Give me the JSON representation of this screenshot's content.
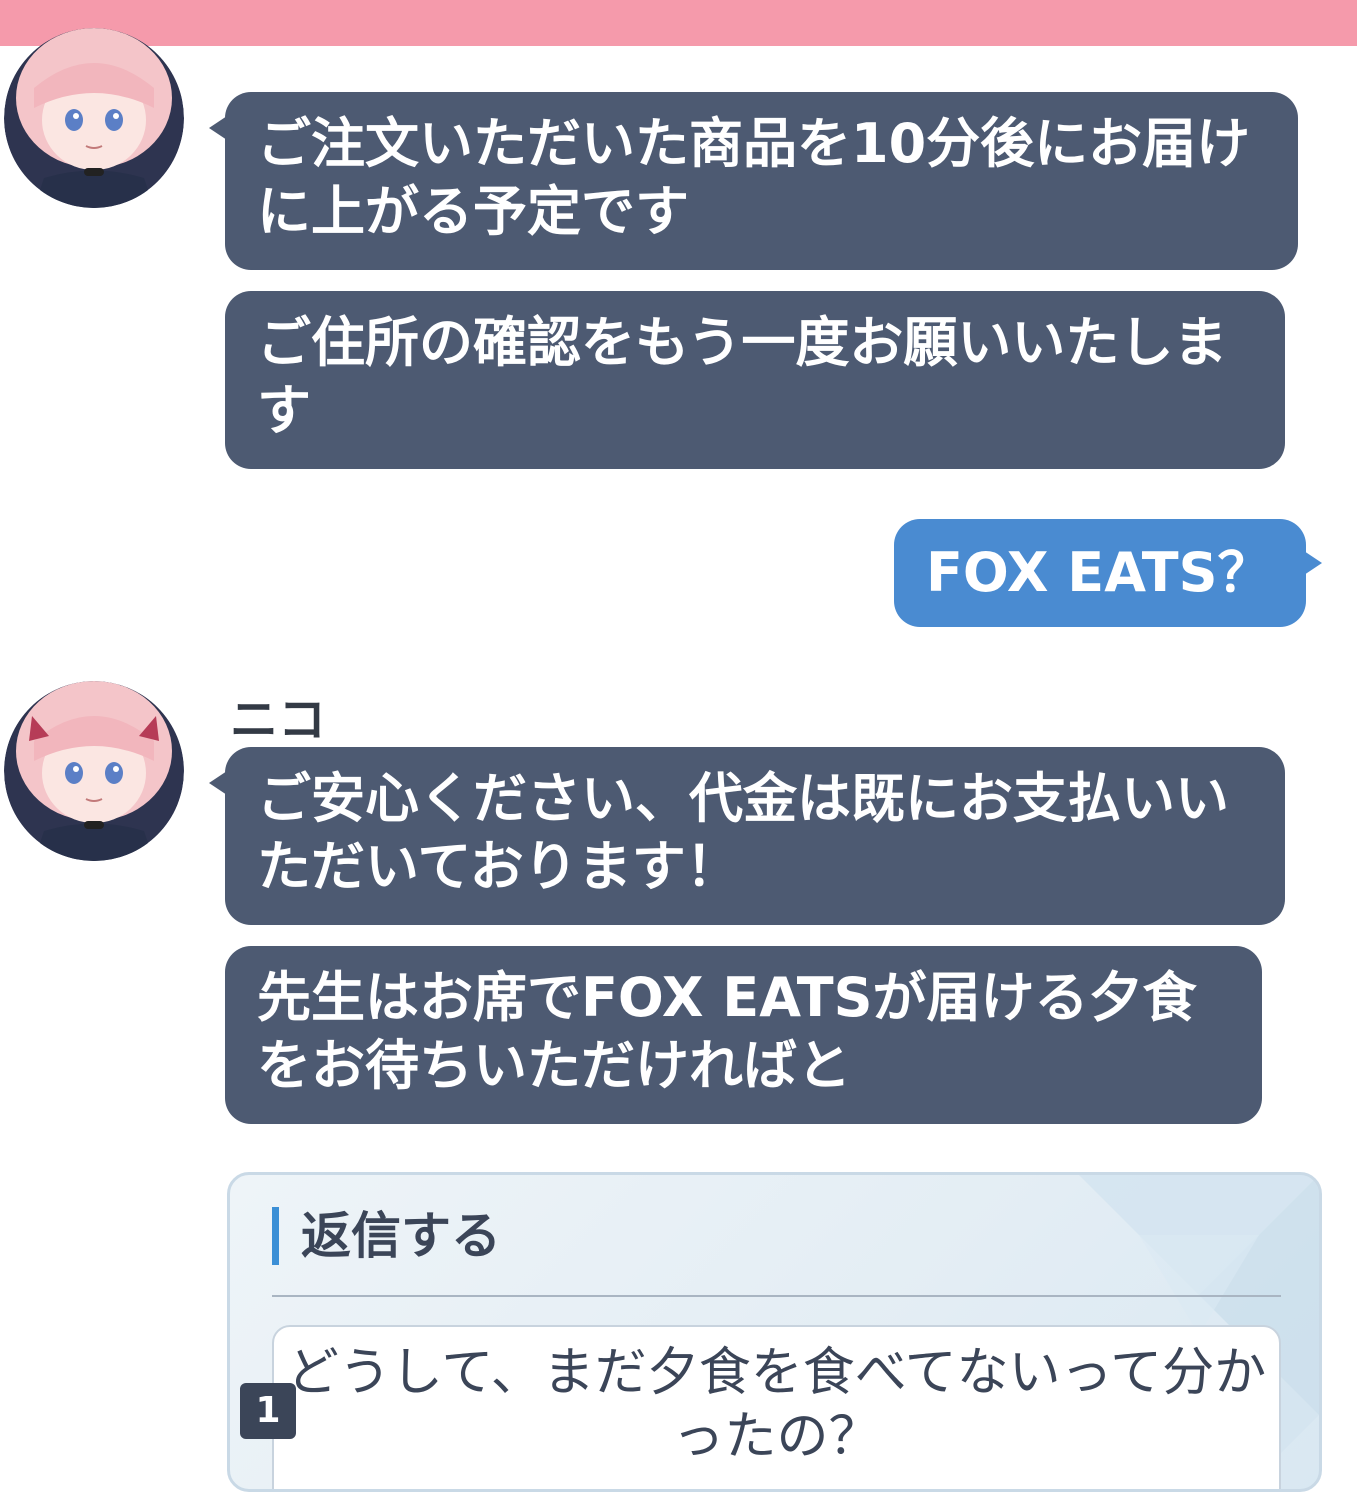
{
  "colors": {
    "topbar": "#f59aab",
    "npc_bubble": "#4d5a72",
    "player_bubble": "#4a8bd1",
    "reply_accent": "#3b8fd6"
  },
  "messages": [
    {
      "sender": "npc",
      "text": "ご注文いただいた商品を10分後にお届けに上がる予定です"
    },
    {
      "sender": "npc",
      "text": "ご住所の確認をもう一度お願いいたします"
    },
    {
      "sender": "player",
      "text": "FOX EATS？"
    },
    {
      "sender": "npc",
      "name": "ニコ",
      "text": "ご安心ください、代金は既にお支払いいただいております！"
    },
    {
      "sender": "npc",
      "text": "先生はお席でFOX EATSが届ける夕食をお待ちいただければと"
    }
  ],
  "reply": {
    "title": "返信する",
    "options": [
      {
        "number": "1",
        "text": "どうして、まだ夕食を食べてないって分かったの？"
      }
    ]
  }
}
